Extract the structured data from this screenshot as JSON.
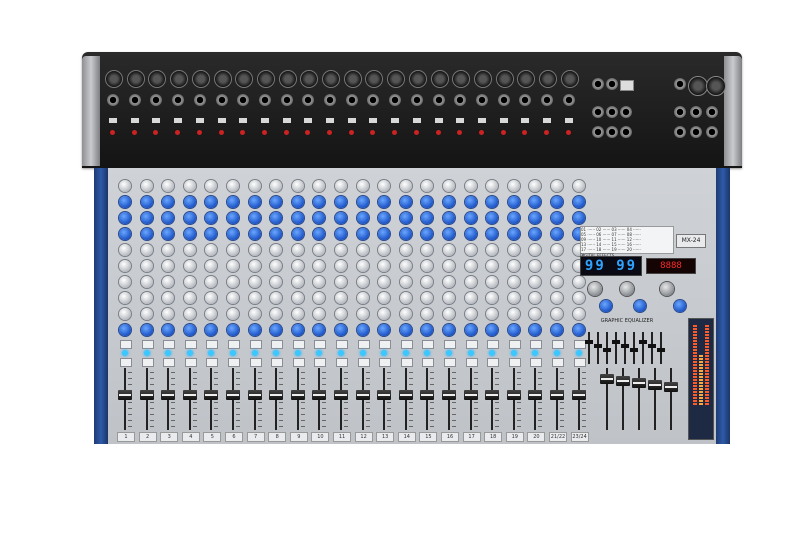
{
  "image": {
    "description_for_alt": "24-channel analog audio mixing console",
    "model_label": "MX-24",
    "display_left": "99",
    "display_right": "99",
    "display_mp3": "8888",
    "display_title": "DIGITAL EFFECTS",
    "geq_title": "GRAPHIC EQUALIZER",
    "master_label": "MAIN",
    "channel_numbers": [
      "1",
      "2",
      "3",
      "4",
      "5",
      "6",
      "7",
      "8",
      "9",
      "10",
      "11",
      "12",
      "13",
      "14",
      "15",
      "16",
      "17",
      "18",
      "19",
      "20",
      "21/22",
      "23/24"
    ],
    "colors": {
      "top_panel": "#1a1a1a",
      "face": "#c8cbd0",
      "side_trim": "#2d5aa8",
      "knob_blue": "#1d55c8",
      "display_blue": "#2fa4ff",
      "display_red": "#ff2a2a"
    }
  }
}
